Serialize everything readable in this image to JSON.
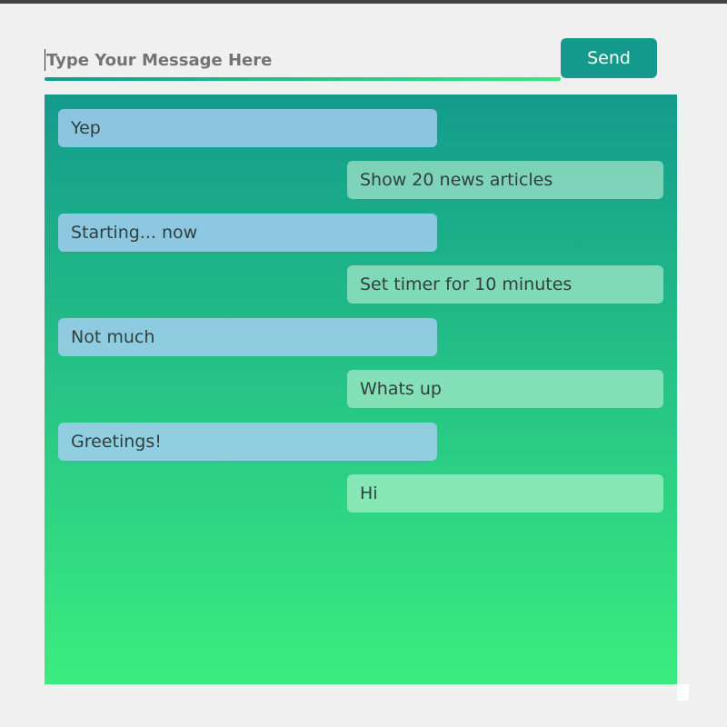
{
  "composer": {
    "placeholder": "Type Your Message Here",
    "value": "",
    "send_label": "Send"
  },
  "messages": [
    {
      "sender": "bot",
      "text": "Yep"
    },
    {
      "sender": "user",
      "text": "Show 20 news articles"
    },
    {
      "sender": "bot",
      "text": "Starting... now"
    },
    {
      "sender": "user",
      "text": "Set timer for 10 minutes"
    },
    {
      "sender": "bot",
      "text": "Not much"
    },
    {
      "sender": "user",
      "text": "Whats up"
    },
    {
      "sender": "bot",
      "text": "Greetings!"
    },
    {
      "sender": "user",
      "text": "Hi"
    }
  ],
  "colors": {
    "send_button": "#149a8c",
    "chat_gradient_top": "#139b8c",
    "chat_gradient_bottom": "#3aed7f"
  }
}
